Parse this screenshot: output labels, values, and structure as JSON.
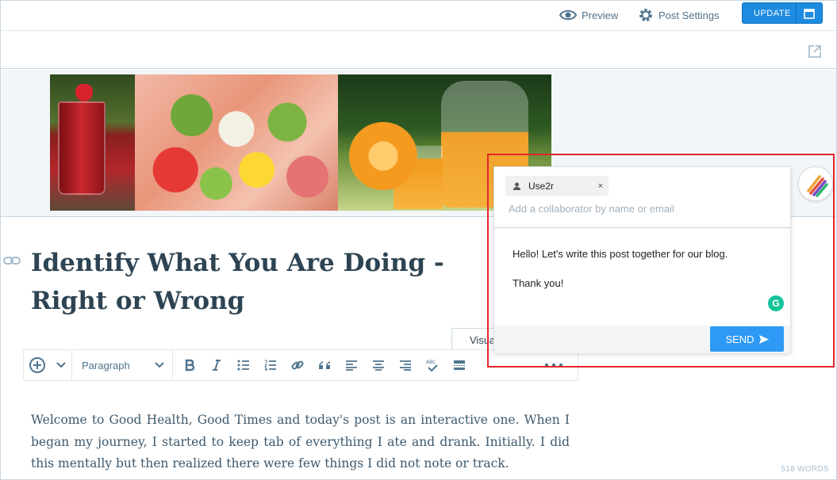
{
  "topbar": {
    "preview_label": "Preview",
    "post_settings_label": "Post Settings",
    "update_label": "UPDATE"
  },
  "icons": {
    "preview": "eye-icon",
    "settings": "gear-icon",
    "calendar": "calendar-icon",
    "external": "external-link-icon",
    "permalink": "link-icon"
  },
  "post": {
    "title": "Identify What You Are Doing - Right or Wrong",
    "body": "Welcome to Good Health, Good Times and today's post is an interactive one. When I began my journey, I started to keep tab of everything I ate and drank. Initially. I did this mentally but then realized there were few things I did not note or track.",
    "word_count": "518 WORDS"
  },
  "editor": {
    "visual_tab": "Visual",
    "format_select": "Paragraph"
  },
  "collab_popup": {
    "collaborator_chip": "Use2r",
    "chip_remove": "×",
    "add_placeholder": "Add a collaborator by name or email",
    "message_line1": "Hello! Let's write this post together for our blog.",
    "message_line2": "Thank you!",
    "grammarly_badge": "G",
    "send_label": "SEND"
  },
  "colors": {
    "accent": "#1d8be0",
    "send": "#2e9af5",
    "highlight_border": "#e3252b",
    "grammarly": "#15c39a"
  }
}
